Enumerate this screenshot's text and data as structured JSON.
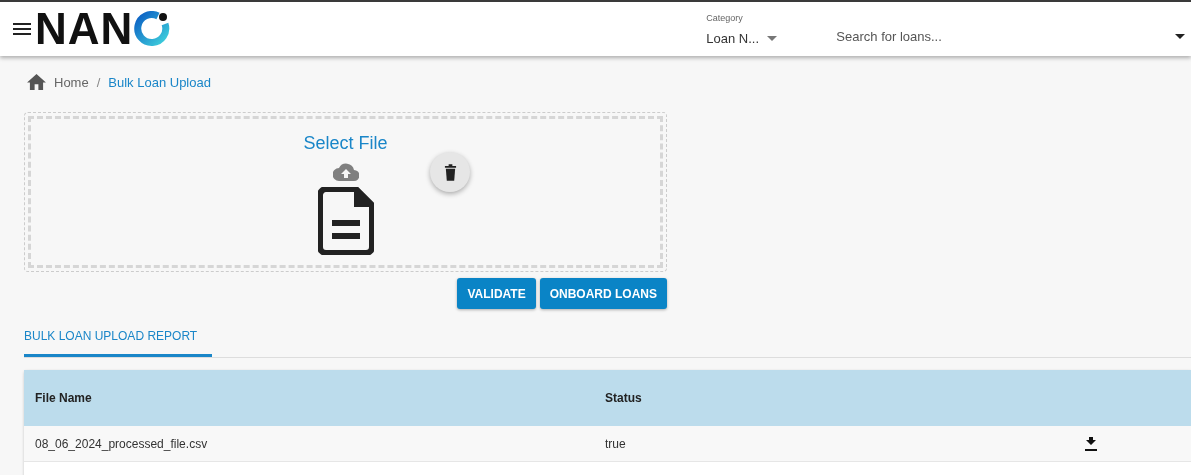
{
  "header": {
    "logo": "NAN",
    "category": {
      "label": "Category",
      "value": "Loan N..."
    },
    "search": {
      "placeholder": "Search for loans..."
    }
  },
  "breadcrumb": [
    "Home",
    "Bulk Loan Upload"
  ],
  "breadcrumb_separator": "/",
  "upload": {
    "title": "Select File"
  },
  "buttons": [
    "VALIDATE",
    "ONBOARD LOANS"
  ],
  "tabs": [
    {
      "label": "BULK LOAN UPLOAD REPORT",
      "selected": true
    }
  ],
  "table": {
    "columns": [
      "File Name",
      "Status"
    ],
    "rows": [
      {
        "file_name": "08_06_2024_processed_file.csv",
        "status": "true"
      }
    ]
  }
}
